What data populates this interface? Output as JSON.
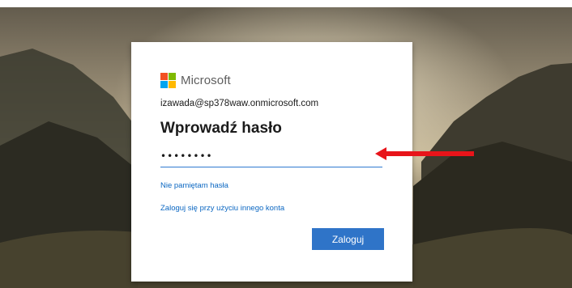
{
  "brand": {
    "name": "Microsoft",
    "colors": [
      "#f25022",
      "#7fba00",
      "#00a4ef",
      "#ffb900"
    ]
  },
  "login": {
    "email": "izawada@sp378waw.onmicrosoft.com",
    "heading": "Wprowadź hasło",
    "password_value": "password",
    "forgot_link": "Nie pamiętam hasła",
    "other_account_link": "Zaloguj się przy użyciu innego konta",
    "submit_label": "Zaloguj"
  },
  "theme": {
    "accent": "#2f74c8",
    "link": "#0b67c2",
    "annotation_arrow": "#e8141a"
  }
}
